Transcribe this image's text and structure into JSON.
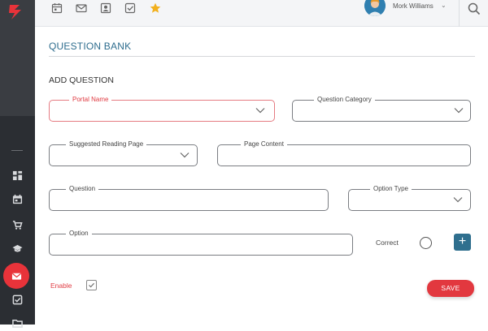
{
  "header": {
    "user_name": "Mork Williams",
    "user_caret": "⌄"
  },
  "page": {
    "title": "QUESTION BANK",
    "section_title": "ADD QUESTION"
  },
  "form": {
    "portal_name": {
      "label": "Portal Name",
      "value": ""
    },
    "question_category": {
      "label": "Question Category",
      "value": ""
    },
    "suggested_reading_page": {
      "label": "Suggested Reading Page",
      "value": ""
    },
    "page_content": {
      "label": "Page Content",
      "value": ""
    },
    "question": {
      "label": "Question",
      "value": ""
    },
    "option_type": {
      "label": "Option Type",
      "value": ""
    },
    "option": {
      "label": "Option",
      "value": ""
    },
    "correct_label": "Correct",
    "add_option_symbol": "+",
    "enable_label": "Enable",
    "enable_checked": true,
    "save_label": "SAVE"
  },
  "colors": {
    "accent_blue": "#2e6d8e",
    "accent_red": "#e2383f",
    "sidebar_bg": "#2b2e33",
    "avatar_bg": "#2f7fb0",
    "star": "#f2b01e"
  },
  "icons": {
    "topbar": [
      "calendar-icon",
      "mail-icon",
      "contact-card-icon",
      "checkbox-icon",
      "star-icon"
    ],
    "sidebar": [
      "dashboard-icon",
      "calendar-icon",
      "cart-icon",
      "graduation-cap-icon",
      "mail-icon",
      "checkbox-icon",
      "folder-icon"
    ]
  }
}
